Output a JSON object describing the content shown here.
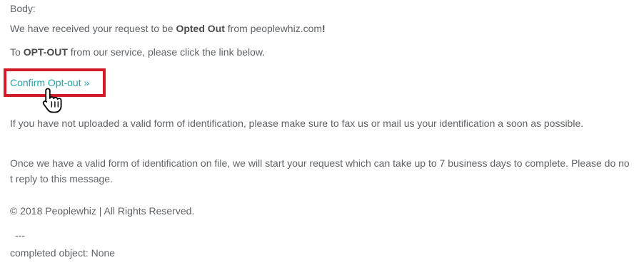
{
  "email": {
    "body_label": "Body:",
    "received": {
      "prefix": "We have received your request to be ",
      "bold": "Opted Out",
      "middle": " from peoplewhiz.com",
      "bold_end": "!"
    },
    "optout": {
      "prefix": "To ",
      "bold": "OPT-OUT",
      "suffix": " from our service, please click the link below."
    },
    "confirm_link": "Confirm Opt-out »",
    "identification_notice": "If you have not uploaded a valid form of identification, please make sure to fax us or mail us your identification a soon as possible.",
    "processing_notice": "Once we have a valid form of identification on file, we will start your request which can take up to 7 business days to complete. Please do not reply to this message.",
    "copyright": "© 2018 Peoplewhiz | All Rights Reserved.",
    "separator": "---",
    "completed_object": "completed object: None"
  },
  "colors": {
    "text": "#5f6368",
    "link": "#22a3a8",
    "highlight_border": "#d11a2a"
  },
  "icons": {
    "cursor": "hand-pointer-icon"
  }
}
